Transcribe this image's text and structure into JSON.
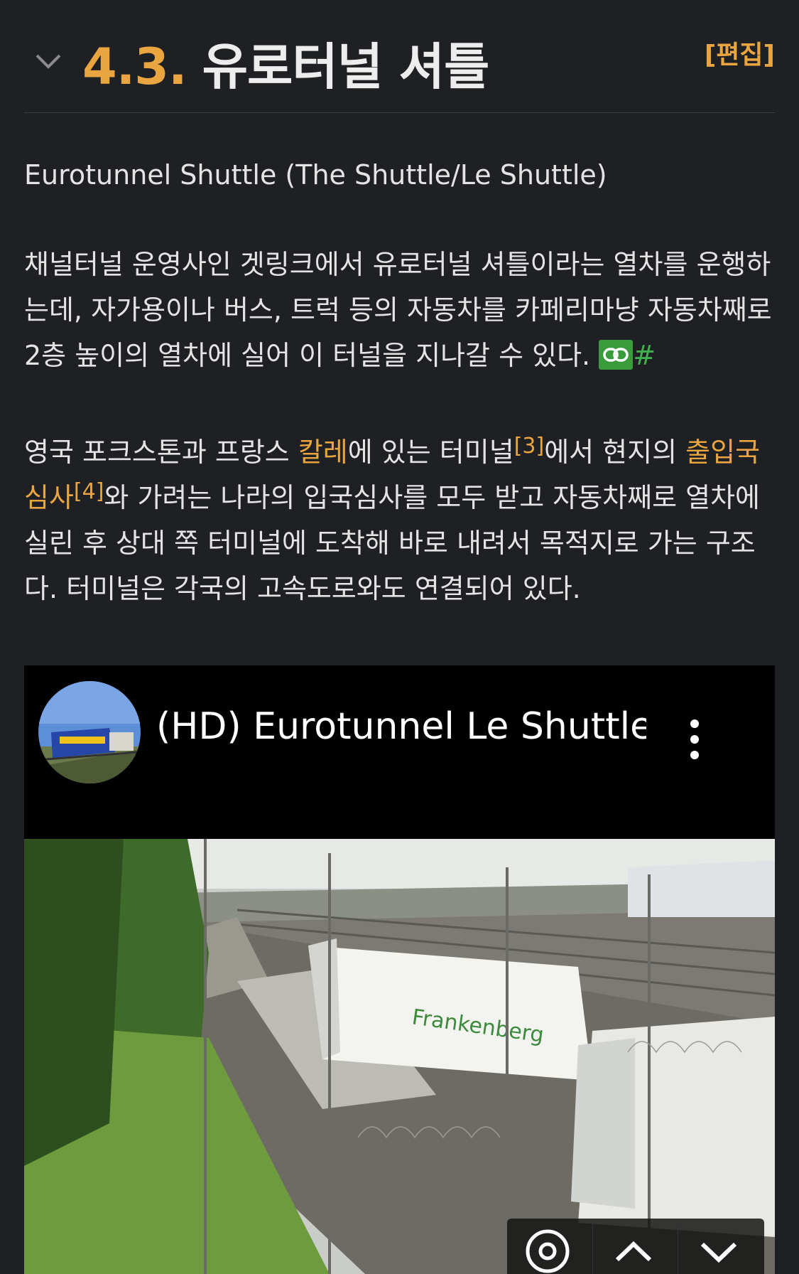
{
  "section": {
    "number": "4.3.",
    "title": "유로터널 셔틀",
    "edit_label": "[편집]"
  },
  "para1": {
    "text": "Eurotunnel Shuttle (The Shuttle/Le Shuttle)"
  },
  "para2": {
    "text": "채널터널 운영사인 겟링크에서 유로터널 셔틀이라는 열차를 운행하는데, 자가용이나 버스, 트럭 등의 자동차를 카페리마냥 자동차째로 2층 높이의 열차에 실어 이 터널을 지나갈 수 있다. ",
    "hash": "#"
  },
  "para3": {
    "t1": "영국 포크스톤과 프랑스 ",
    "link1": "칼레",
    "t2": "에 있는 터미널",
    "ref1": "[3]",
    "t3": "에서 현지의 ",
    "link2": "출입국 심사",
    "ref2": "[4]",
    "t4": "와 가려는 나라의 입국심사를 모두 받고 자동차째로 열차에 실린 후 상대 쪽 터미널에 도착해 바로 내려서 목적지로 가는 구조다. 터미널은 각국의 고속도로와도 연결되어 있다."
  },
  "video": {
    "title": "(HD) Eurotunnel Le Shuttle ...",
    "truck_brand": "Frankenberg"
  },
  "colors": {
    "accent": "#e9a53f",
    "background": "#1f2023",
    "link_icon_bg": "#3a9b3a"
  },
  "icons": {
    "collapse": "chevron-down-icon",
    "permalink": "link-icon",
    "video_menu": "more-vert-icon",
    "settings": "gear-icon",
    "prev": "chevron-up-icon",
    "next": "chevron-down-icon"
  }
}
